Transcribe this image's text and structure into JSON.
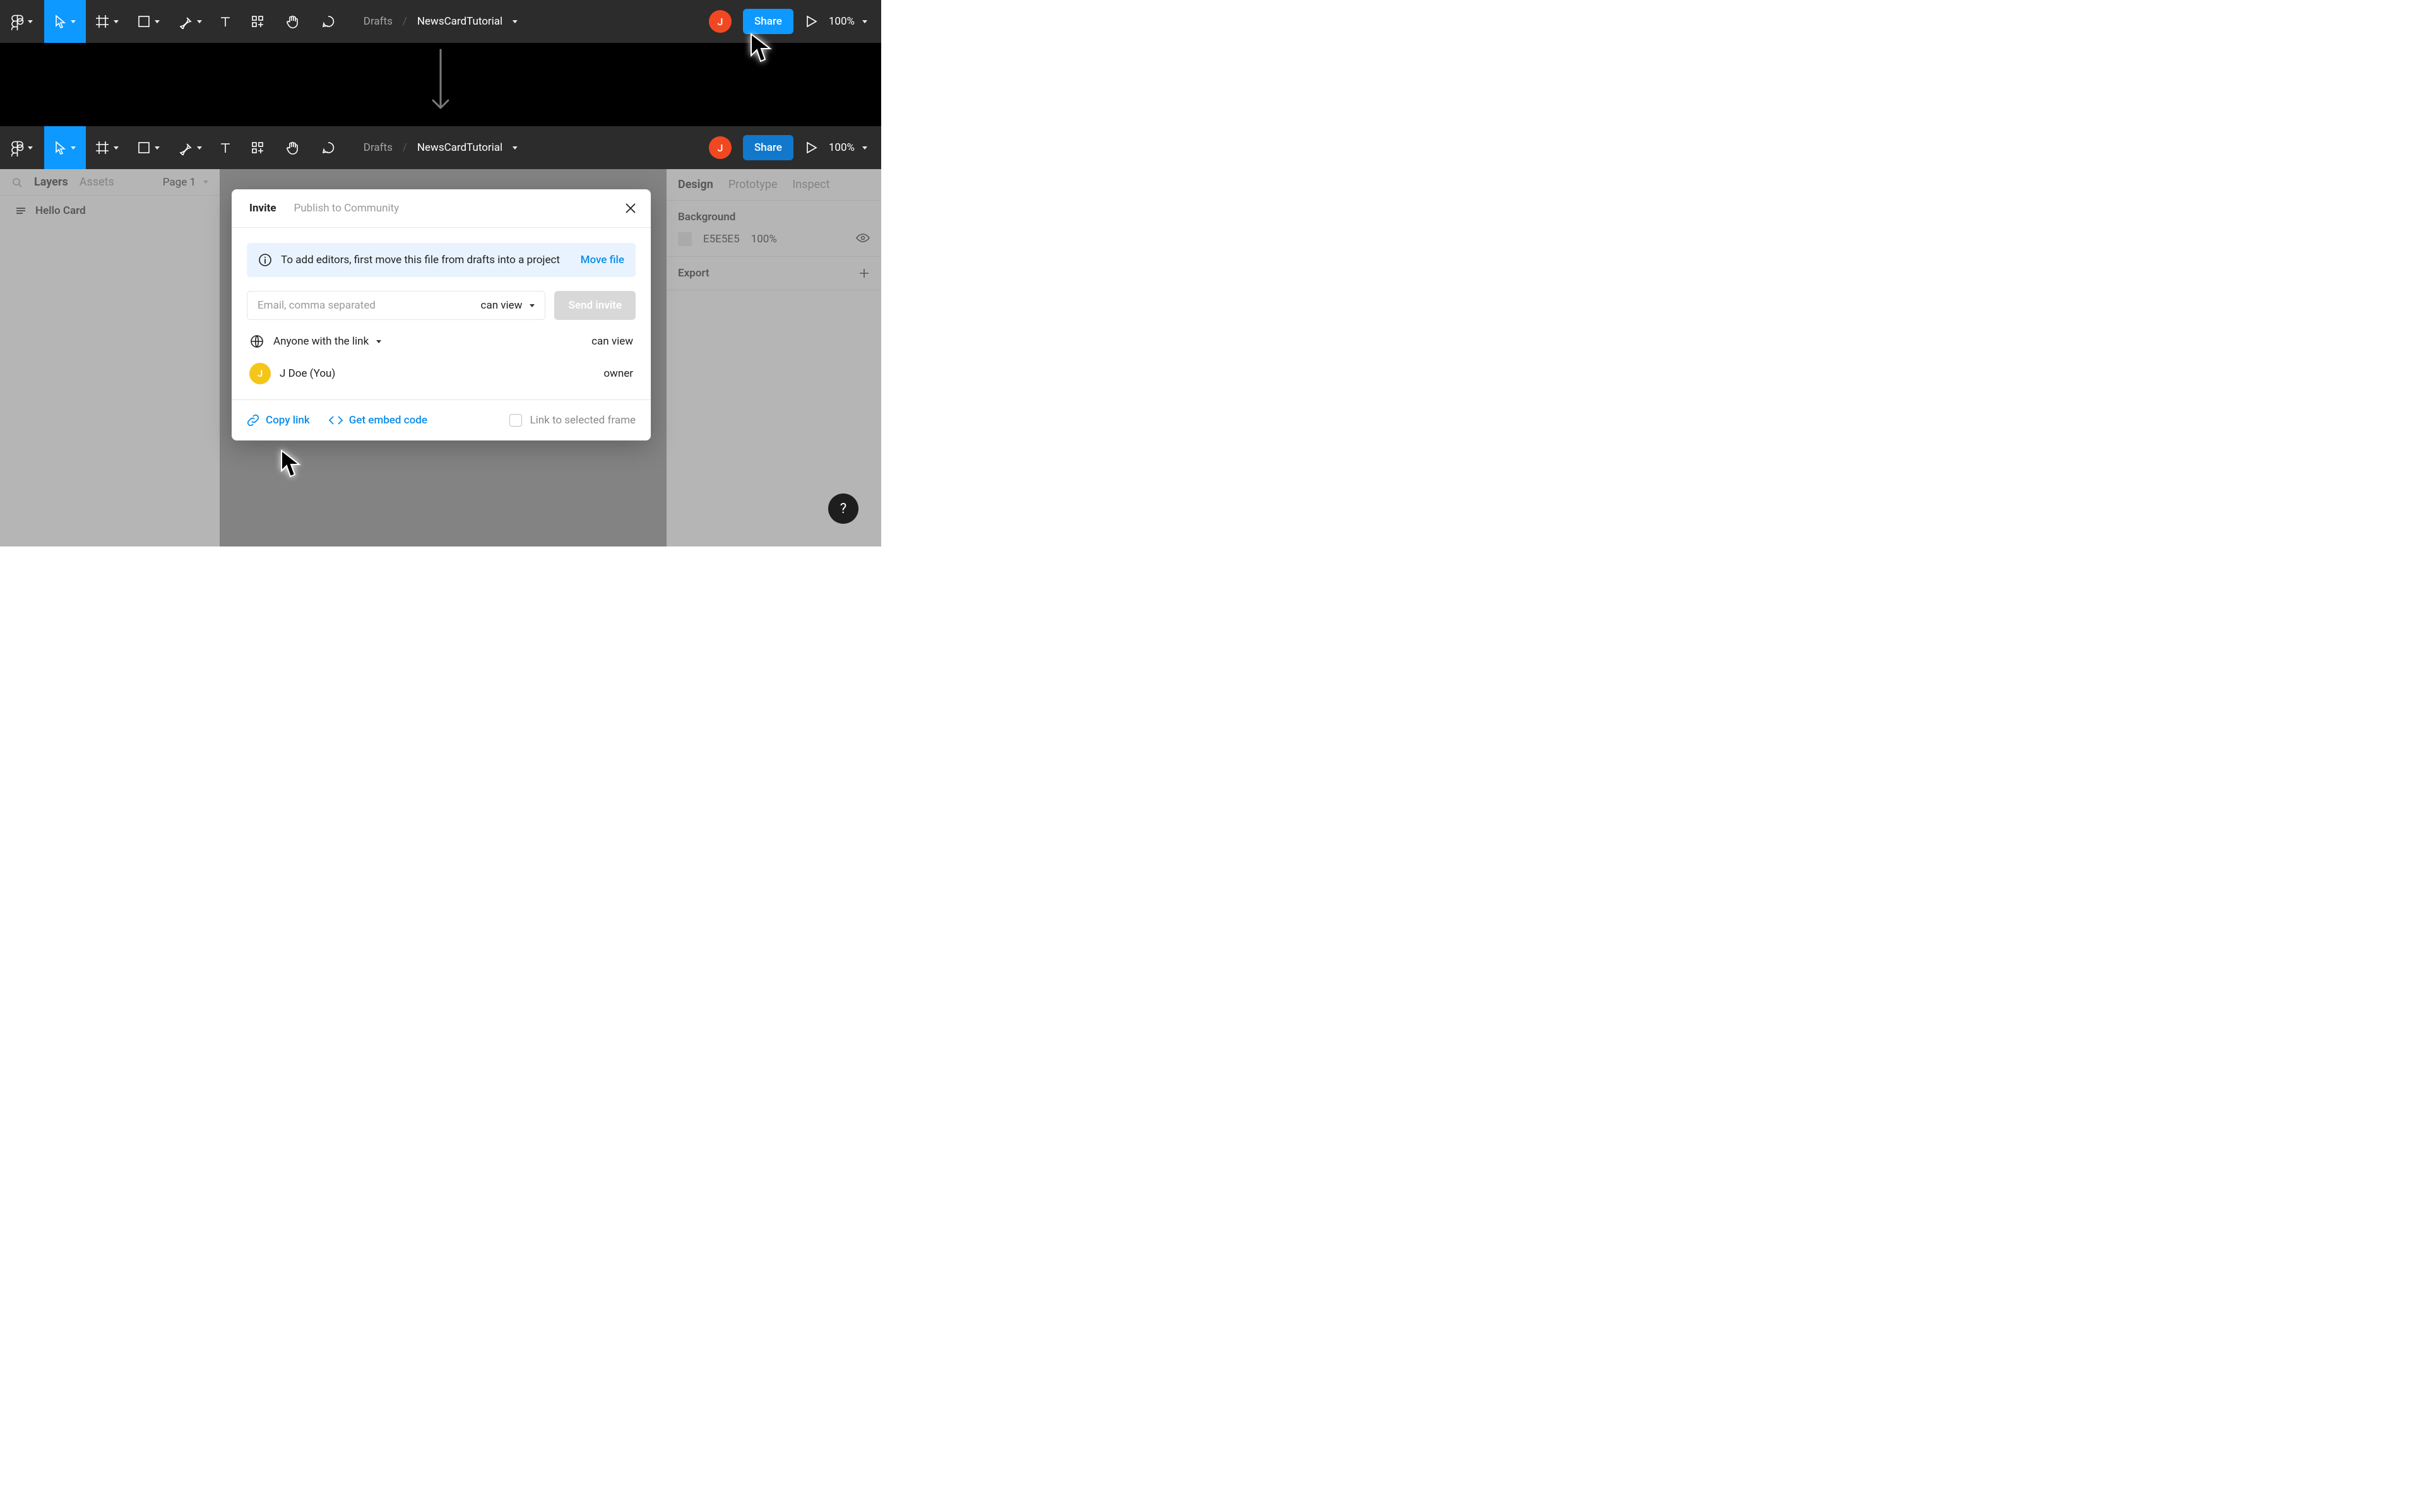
{
  "breadcrumb": {
    "drafts": "Drafts",
    "sep": "/",
    "file": "NewsCardTutorial"
  },
  "avatar_letter": "J",
  "share_label": "Share",
  "zoom_label": "100%",
  "left_panel": {
    "tab_layers": "Layers",
    "tab_assets": "Assets",
    "page_label": "Page 1",
    "layer_name": "Hello Card"
  },
  "right_panel": {
    "tab_design": "Design",
    "tab_prototype": "Prototype",
    "tab_inspect": "Inspect",
    "bg_heading": "Background",
    "bg_hex": "E5E5E5",
    "bg_opacity": "100%",
    "export_heading": "Export"
  },
  "dialog": {
    "tab_invite": "Invite",
    "tab_publish": "Publish to Community",
    "info_msg": "To add editors, first move this file from drafts into a project",
    "info_action": "Move file",
    "email_placeholder": "Email, comma separated",
    "perm_can_view": "can view",
    "send_label": "Send invite",
    "anyone_label": "Anyone with the link",
    "anyone_perm": "can view",
    "user_initial": "J",
    "user_label": "J Doe (You)",
    "user_perm": "owner",
    "copy_link": "Copy link",
    "embed_code": "Get embed code",
    "link_frame_label": "Link to selected frame"
  },
  "help_label": "?"
}
